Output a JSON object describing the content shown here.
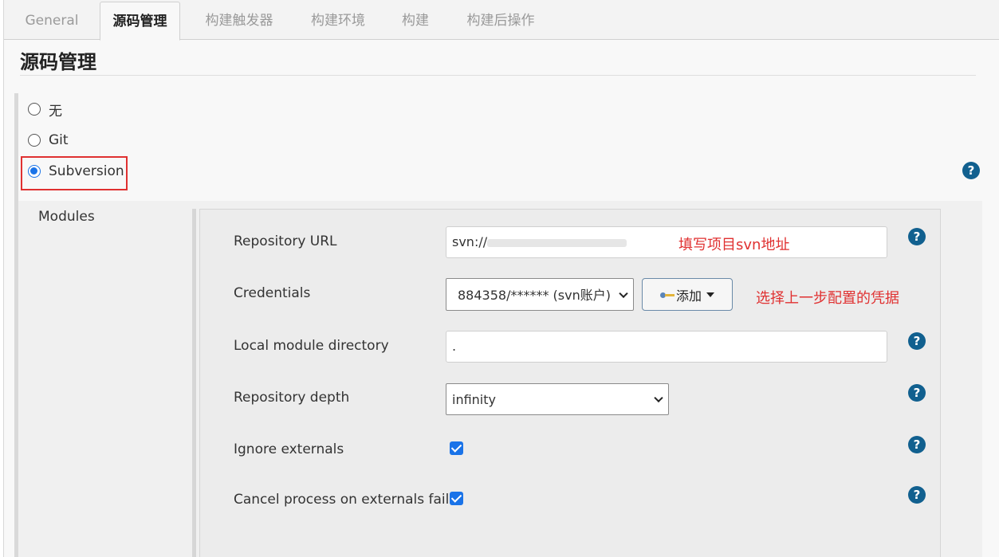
{
  "tabs": [
    {
      "label": "General",
      "active": false
    },
    {
      "label": "源码管理",
      "active": true
    },
    {
      "label": "构建触发器",
      "active": false
    },
    {
      "label": "构建环境",
      "active": false
    },
    {
      "label": "构建",
      "active": false
    },
    {
      "label": "构建后操作",
      "active": false
    }
  ],
  "section": {
    "title": "源码管理"
  },
  "scm_options": [
    {
      "label": "无",
      "selected": false
    },
    {
      "label": "Git",
      "selected": false
    },
    {
      "label": "Subversion",
      "selected": true
    }
  ],
  "modules": {
    "label": "Modules",
    "repository_url": {
      "label": "Repository URL",
      "value": "svn://",
      "annotation": "填写项目svn地址"
    },
    "credentials": {
      "label": "Credentials",
      "selected": "884358/****** (svn账户)",
      "add_label": "添加",
      "annotation": "选择上一步配置的凭据"
    },
    "local_module_directory": {
      "label": "Local module directory",
      "value": "."
    },
    "repository_depth": {
      "label": "Repository depth",
      "selected": "infinity"
    },
    "ignore_externals": {
      "label": "Ignore externals",
      "checked": true
    },
    "cancel_process": {
      "label": "Cancel process on externals fail",
      "checked": true
    }
  },
  "help_icon": "?",
  "colors": {
    "accent": "#1a73e8",
    "help": "#11608f",
    "annotation": "#e03131"
  },
  "icons": [
    "key-icon",
    "help-icon",
    "chevron-down-icon",
    "caret-down-icon",
    "check-icon"
  ]
}
